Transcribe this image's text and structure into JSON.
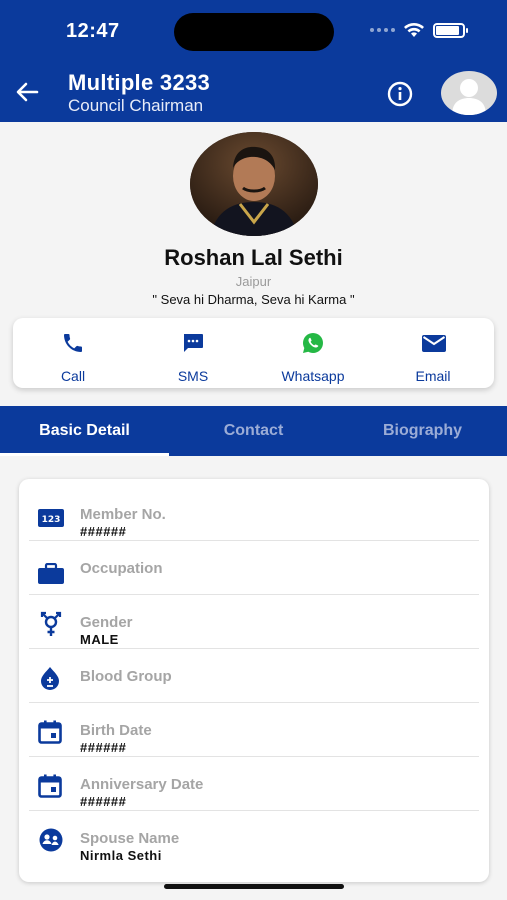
{
  "status_bar": {
    "time": "12:47",
    "battery_level": 0.9
  },
  "header": {
    "title": "Multiple 3233",
    "subtitle": "Council Chairman"
  },
  "profile": {
    "name": "Roshan Lal Sethi",
    "city": "Jaipur",
    "motto": "\" Seva hi Dharma, Seva hi Karma \""
  },
  "actions": [
    {
      "label": "Call",
      "icon": "phone-icon"
    },
    {
      "label": "SMS",
      "icon": "sms-icon"
    },
    {
      "label": "Whatsapp",
      "icon": "whatsapp-icon"
    },
    {
      "label": "Email",
      "icon": "email-icon"
    }
  ],
  "tabs": [
    {
      "label": "Basic Detail",
      "active": true
    },
    {
      "label": "Contact",
      "active": false
    },
    {
      "label": "Biography",
      "active": false
    }
  ],
  "details": [
    {
      "label": "Member No.",
      "value": "######",
      "icon": "number-badge-icon"
    },
    {
      "label": "Occupation",
      "value": "",
      "icon": "briefcase-icon"
    },
    {
      "label": "Gender",
      "value": "MALE",
      "icon": "gender-icon"
    },
    {
      "label": "Blood Group",
      "value": "",
      "icon": "blood-drop-icon"
    },
    {
      "label": "Birth Date",
      "value": "######",
      "icon": "calendar-icon"
    },
    {
      "label": "Anniversary Date",
      "value": "######",
      "icon": "calendar-icon"
    },
    {
      "label": "Spouse Name",
      "value": "Nirmla Sethi",
      "icon": "spouse-icon"
    }
  ],
  "colors": {
    "primary": "#0b3a9c",
    "whatsapp": "#25b845",
    "background": "#f4f4f4"
  }
}
